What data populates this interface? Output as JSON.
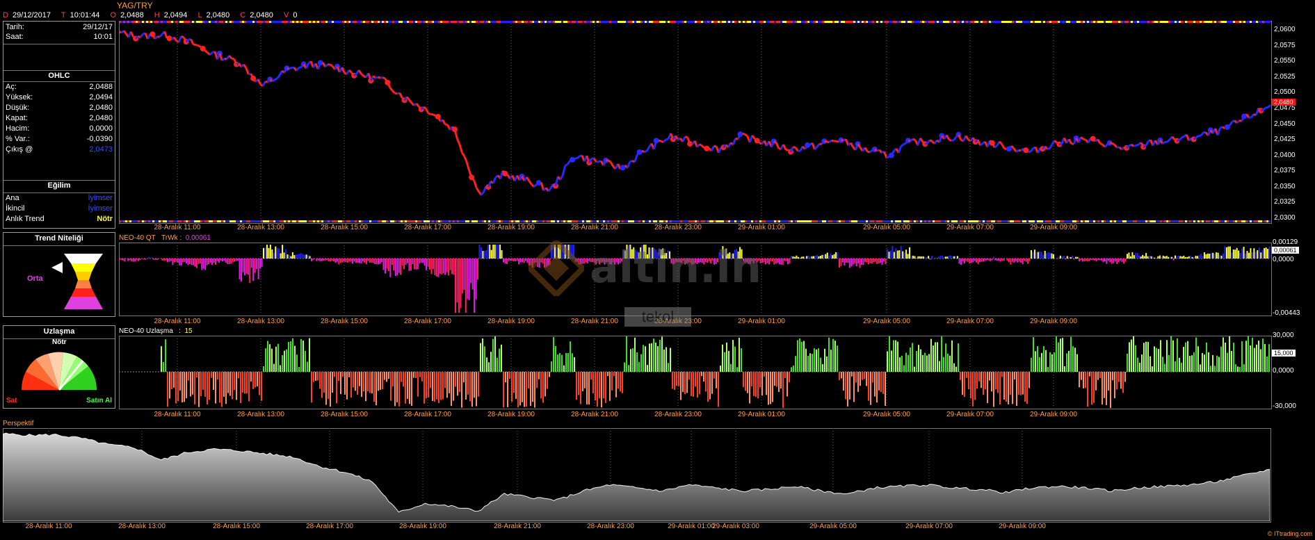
{
  "header": {
    "date_label": "D",
    "date": "29/12/2017",
    "time_label": "T",
    "time": "10:01:44",
    "open_label": "O",
    "open": "2,0488",
    "high_label": "H",
    "high": "2,0494",
    "low_label": "L",
    "low": "2,0480",
    "close_label": "C",
    "close": "2,0480",
    "volume_label": "V",
    "volume": "0"
  },
  "symbol": "YAG/TRY",
  "info": {
    "tarih_label": "Tarih:",
    "tarih": "29/12/17",
    "saat_label": "Saat:",
    "saat": "10:01",
    "ohlc_title": "OHLC",
    "rows": [
      {
        "label": "Aç:",
        "value": "2,0488"
      },
      {
        "label": "Yüksek:",
        "value": "2,0494"
      },
      {
        "label": "Düşük:",
        "value": "2,0480"
      },
      {
        "label": "Kapat:",
        "value": "2,0480"
      },
      {
        "label": "Hacim:",
        "value": "0,0000"
      },
      {
        "label": "% Var.:",
        "value": "-0,0390"
      },
      {
        "label": "Çıkış @",
        "value": "2,0473"
      }
    ],
    "egilim_title": "Eğilim",
    "egilim": [
      {
        "label": "Ana",
        "value": "İyimser",
        "color": "#3050ff"
      },
      {
        "label": "İkincil",
        "value": "İyimser",
        "color": "#3050ff"
      },
      {
        "label": "Anlık Trend",
        "value": "Nötr",
        "color": "#ffff40"
      }
    ]
  },
  "trend_panel": {
    "title": "Trend Niteliği",
    "state": "Orta",
    "state_color": "#e040e0"
  },
  "uzlasma_panel": {
    "title": "Uzlaşma",
    "top": "Nötr",
    "left": "Sat",
    "right": "Satın Al"
  },
  "colors": {
    "bull": "#2020ff",
    "bear": "#ff2020",
    "label": "#ffa040",
    "osc_pos": "#40d020",
    "osc_neg": "#e04020"
  },
  "watermark": {
    "brand": "altin.in",
    "sub": "tekol"
  },
  "credit": "© ITtrading.com",
  "price_chart": {
    "y_ticks": [
      "2,0600",
      "2,0575",
      "2,0550",
      "2,0525",
      "2,0500",
      "2,0475",
      "2,0450",
      "2,0425",
      "2,0400",
      "2,0375",
      "2,0350",
      "2,0325",
      "2,0300"
    ],
    "current": "2,0480",
    "x_ticks": [
      "28-Aralık 11:00",
      "28-Aralık 13:00",
      "28-Aralık 15:00",
      "28-Aralık 17:00",
      "28-Aralık 19:00",
      "28-Aralık 21:00",
      "28-Aralık 23:00",
      "29-Aralık 01:00",
      "29-Aralık 05:00",
      "29-Aralık 07:00",
      "29-Aralık 09:00"
    ]
  },
  "neo_qt": {
    "name": "NEO-40 QT",
    "label": "TrWk :",
    "value": "0,00061",
    "y_ticks": [
      "0,00129",
      "0,0000",
      "-0,00443"
    ],
    "current": "0,00061"
  },
  "neo_uz": {
    "name": "NEO-40 Uzlaşma",
    "sep": ":",
    "value": "15",
    "y_ticks": [
      "30,000",
      "0,0000",
      "-30,000"
    ],
    "current": "15,000"
  },
  "perspektif": {
    "name": "Perspektif",
    "x_ticks": [
      "28-Aralık 11:00",
      "28-Aralık 13:00",
      "28-Aralık 15:00",
      "28-Aralık 17:00",
      "28-Aralık 19:00",
      "28-Aralık 21:00",
      "28-Aralık 23:00",
      "29-Aralık 01:00",
      "29-Aralık 03:00",
      "29-Aralık 05:00",
      "29-Aralık 07:00",
      "29-Aralık 09:00"
    ]
  },
  "chart_data": {
    "type": "line",
    "title": "YAG/TRY",
    "ylim": [
      2.03,
      2.061
    ],
    "x": [
      "28-Aralık 10:00",
      "28-Aralık 10:30",
      "28-Aralık 11:00",
      "28-Aralık 11:30",
      "28-Aralık 12:00",
      "28-Aralık 12:30",
      "28-Aralık 13:00",
      "28-Aralık 13:30",
      "28-Aralık 14:00",
      "28-Aralık 14:30",
      "28-Aralık 15:00",
      "28-Aralık 15:30",
      "28-Aralık 16:00",
      "28-Aralık 16:30",
      "28-Aralık 17:00",
      "28-Aralık 17:30",
      "28-Aralık 18:00",
      "28-Aralık 18:30",
      "28-Aralık 19:00",
      "28-Aralık 19:30",
      "28-Aralık 20:00",
      "28-Aralık 20:30",
      "28-Aralık 21:00",
      "28-Aralık 21:30",
      "28-Aralık 22:00",
      "28-Aralık 22:30",
      "28-Aralık 23:00",
      "28-Aralık 23:30",
      "29-Aralık 00:00",
      "29-Aralık 00:30",
      "29-Aralık 01:00",
      "29-Aralık 01:30",
      "29-Aralık 02:00",
      "29-Aralık 02:30",
      "29-Aralık 03:00",
      "29-Aralık 03:30",
      "29-Aralık 04:00",
      "29-Aralık 04:30",
      "29-Aralık 05:00",
      "29-Aralık 05:30",
      "29-Aralık 06:00",
      "29-Aralık 06:30",
      "29-Aralık 07:00",
      "29-Aralık 07:30",
      "29-Aralık 08:00",
      "29-Aralık 08:30",
      "29-Aralık 09:00",
      "29-Aralık 09:30",
      "29-Aralık 10:00"
    ],
    "series": [
      {
        "values": [
          2.0595,
          2.059,
          2.0592,
          2.058,
          2.056,
          2.055,
          2.051,
          2.0535,
          2.0545,
          2.054,
          2.053,
          2.052,
          2.049,
          2.047,
          2.044,
          2.034,
          2.037,
          2.036,
          2.0345,
          2.04,
          2.039,
          2.038,
          2.041,
          2.043,
          2.042,
          2.041,
          2.043,
          2.042,
          2.041,
          2.0415,
          2.0425,
          2.041,
          2.04,
          2.042,
          2.0425,
          2.043,
          2.042,
          2.0415,
          2.0405,
          2.042,
          2.0425,
          2.042,
          2.041,
          2.042,
          2.0425,
          2.043,
          2.044,
          2.046,
          2.048
        ]
      }
    ]
  }
}
